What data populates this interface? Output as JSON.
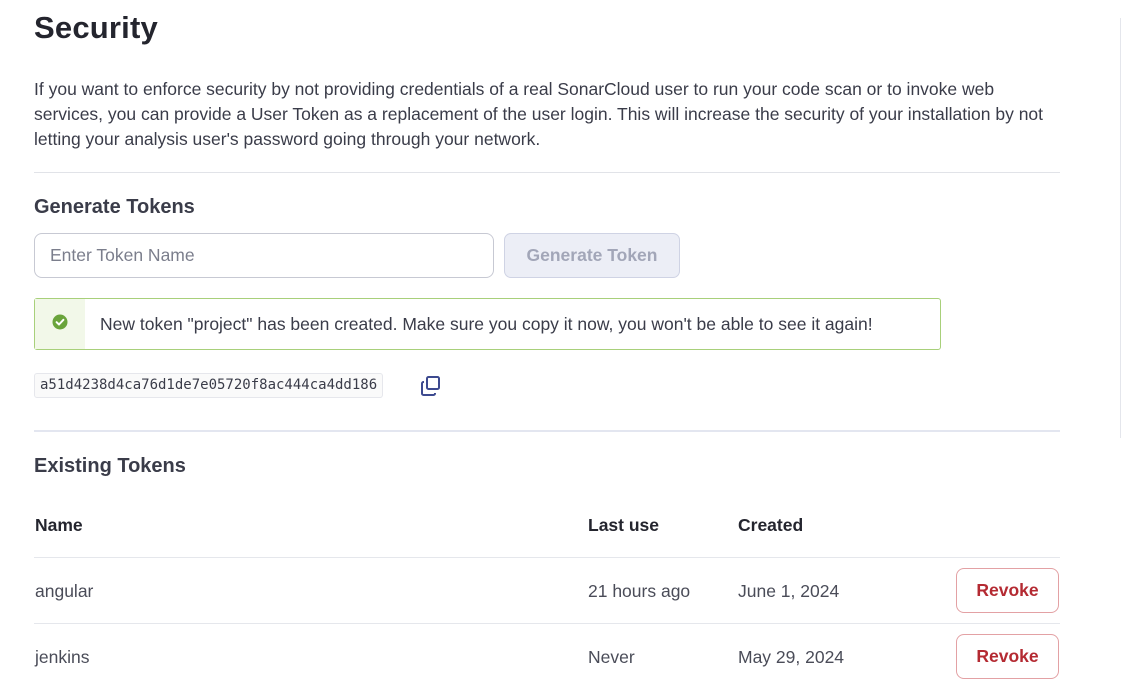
{
  "page": {
    "title": "Security",
    "intro": "If you want to enforce security by not providing credentials of a real SonarCloud user to run your code scan or to invoke web services, you can provide a User Token as a replacement of the user login. This will increase the security of your installation by not letting your analysis user's password going through your network."
  },
  "generate": {
    "title": "Generate Tokens",
    "input_placeholder": "Enter Token Name",
    "input_value": "",
    "button_label": "Generate Token",
    "alert_text": "New token \"project\" has been created. Make sure you copy it now, you won't be able to see it again!",
    "alert_icon": "check-circle-icon",
    "token_value": "a51d4238d4ca76d1de7e05720f8ac444ca4dd186",
    "copy_icon": "copy-icon"
  },
  "existing": {
    "title": "Existing Tokens",
    "columns": {
      "name": "Name",
      "last_use": "Last use",
      "created": "Created"
    },
    "rows": [
      {
        "name": "angular",
        "last_use": "21 hours ago",
        "created": "June 1, 2024",
        "action": "Revoke"
      },
      {
        "name": "jenkins",
        "last_use": "Never",
        "created": "May 29, 2024",
        "action": "Revoke"
      }
    ]
  },
  "colors": {
    "success": "#6aa43b",
    "danger": "#b42a32",
    "accent": "#3d4a8f"
  }
}
